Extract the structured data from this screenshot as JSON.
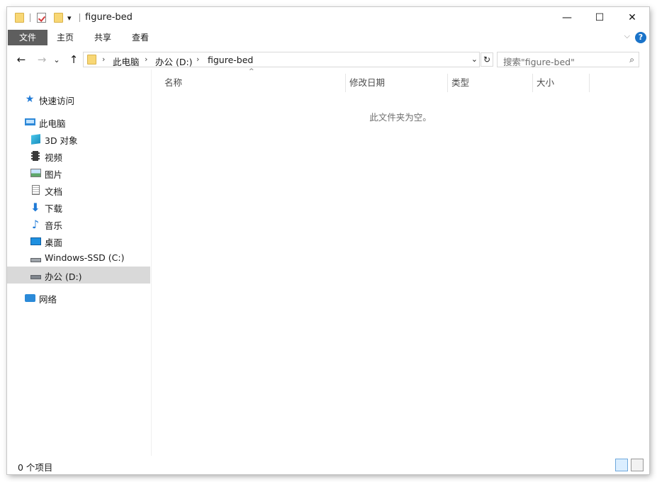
{
  "window": {
    "title": "figure-bed",
    "qa_dropdown": "▾",
    "controls": {
      "minimize": "—",
      "maximize": "☐",
      "close": "✕"
    }
  },
  "ribbon": {
    "tabs": [
      "文件",
      "主页",
      "共享",
      "查看"
    ],
    "active_tab": "文件",
    "expand_chevron": "⌵",
    "help": "?"
  },
  "nav": {
    "back": "←",
    "forward": "→",
    "recent": "⌄",
    "up": "↑",
    "breadcrumbs": [
      "此电脑",
      "办公 (D:)",
      "figure-bed"
    ],
    "separator": "›",
    "address_dropdown": "⌄",
    "refresh": "↻",
    "search_placeholder": "搜索\"figure-bed\"",
    "search_icon": "⌕"
  },
  "sidebar": {
    "quick_access": "快速访问",
    "this_pc": "此电脑",
    "items": [
      {
        "label": "3D 对象",
        "icon": "cube-icon"
      },
      {
        "label": "视频",
        "icon": "video-icon"
      },
      {
        "label": "图片",
        "icon": "pictures-icon"
      },
      {
        "label": "文档",
        "icon": "documents-icon"
      },
      {
        "label": "下载",
        "icon": "download-icon"
      },
      {
        "label": "音乐",
        "icon": "music-icon"
      },
      {
        "label": "桌面",
        "icon": "desktop-icon"
      },
      {
        "label": "Windows-SSD (C:)",
        "icon": "drive-c-icon"
      },
      {
        "label": "办公 (D:)",
        "icon": "drive-d-icon",
        "selected": true
      }
    ],
    "network": "网络",
    "selected_color": "#d9d9d9"
  },
  "content": {
    "columns": [
      "名称",
      "修改日期",
      "类型",
      "大小"
    ],
    "sort_indicator": "^",
    "empty_message": "此文件夹为空。"
  },
  "status": {
    "item_count": "0 个项目"
  },
  "colors": {
    "file_tab_bg": "#5e5e5e",
    "accent": "#1a73c9",
    "folder": "#f8d775"
  }
}
